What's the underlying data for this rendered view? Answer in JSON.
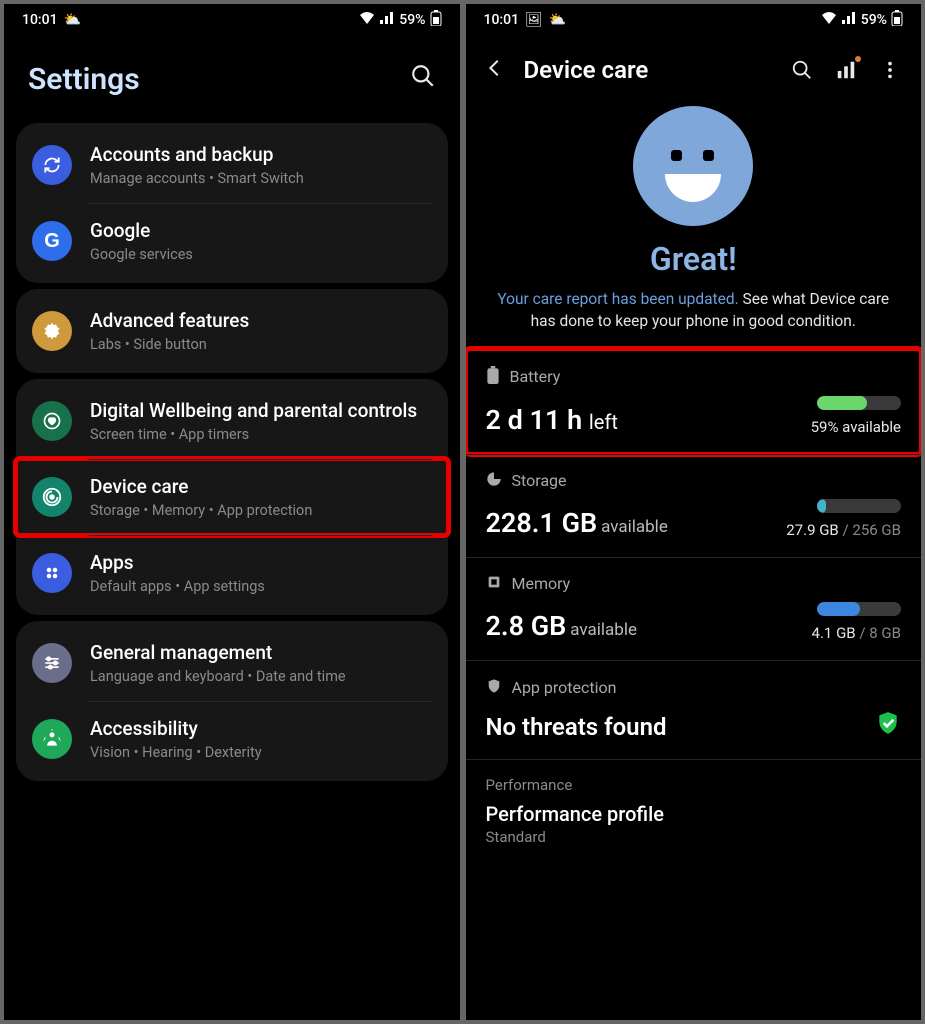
{
  "status": {
    "time": "10:01",
    "battery_pct": "59%"
  },
  "left": {
    "header": "Settings",
    "groups": [
      {
        "items": [
          {
            "key": "accounts",
            "title": "Accounts and backup",
            "sub": "Manage accounts  •  Smart Switch",
            "chip": "#3b5de0",
            "icon": "sync"
          },
          {
            "key": "google",
            "title": "Google",
            "sub": "Google services",
            "chip": "#2f6eea",
            "icon": "G"
          }
        ]
      },
      {
        "items": [
          {
            "key": "advanced",
            "title": "Advanced features",
            "sub": "Labs  •  Side button",
            "chip": "#cf9a3b",
            "icon": "gear"
          }
        ]
      },
      {
        "items": [
          {
            "key": "wellbeing",
            "title": "Digital Wellbeing and parental controls",
            "sub": "Screen time  •  App timers",
            "chip": "#17724c",
            "icon": "heart"
          },
          {
            "key": "devicecare",
            "title": "Device care",
            "sub": "Storage  •  Memory  •  App protection",
            "chip": "#13846c",
            "icon": "spin",
            "highlight": true
          },
          {
            "key": "apps",
            "title": "Apps",
            "sub": "Default apps  •  App settings",
            "chip": "#3b5de0",
            "icon": "grid4"
          }
        ]
      },
      {
        "items": [
          {
            "key": "general",
            "title": "General management",
            "sub": "Language and keyboard  •  Date and time",
            "chip": "#6a6e8a",
            "icon": "sliders"
          },
          {
            "key": "accessibility",
            "title": "Accessibility",
            "sub": "Vision  •  Hearing  •  Dexterity",
            "chip": "#1fa85a",
            "icon": "person"
          }
        ]
      }
    ]
  },
  "right": {
    "title": "Device care",
    "status_word": "Great!",
    "report_blue": "Your care report has been updated.",
    "report_rest": " See what Device care has done to keep your phone in good condition.",
    "battery": {
      "label": "Battery",
      "time_big": "2 d 11 h",
      "time_suffix": "left",
      "avail": "59% available",
      "fill_pct": 59,
      "fill_color": "#6cd66c",
      "highlight": true
    },
    "storage": {
      "label": "Storage",
      "big": "228.1 GB",
      "big_suffix": "available",
      "used": "27.9 GB",
      "total": "256 GB",
      "fill_pct": 11,
      "fill_color": "#43b4c8"
    },
    "memory": {
      "label": "Memory",
      "big": "2.8 GB",
      "big_suffix": "available",
      "used": "4.1 GB",
      "total": "8 GB",
      "fill_pct": 51,
      "fill_color": "#3d86e0"
    },
    "app_protection": {
      "label": "App protection",
      "status": "No threats found"
    },
    "performance": {
      "section": "Performance",
      "title": "Performance profile",
      "value": "Standard"
    }
  }
}
